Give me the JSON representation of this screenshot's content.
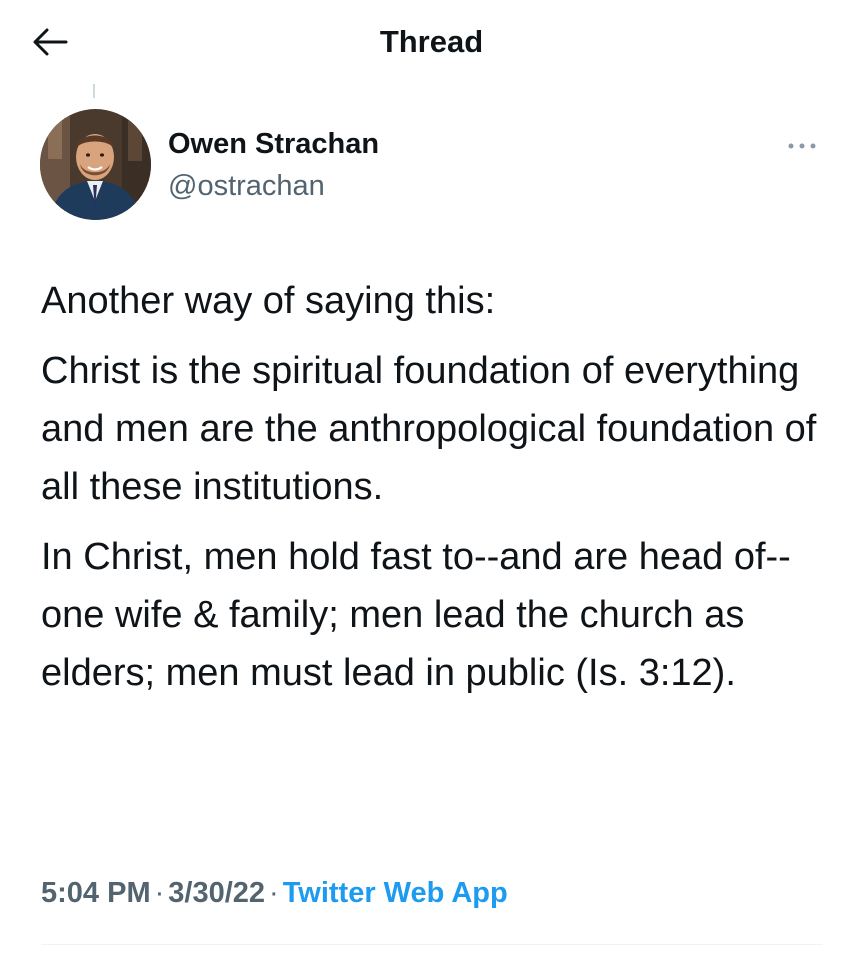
{
  "header": {
    "title": "Thread",
    "back_icon": "arrow-left-icon"
  },
  "tweet": {
    "author": {
      "name": "Owen Strachan",
      "handle": "@ostrachan",
      "avatar": "profile-photo"
    },
    "more_icon": "more-horizontal-icon",
    "paragraphs": [
      "Another way of saying this:",
      "Christ is the spiritual foundation of everything and men are the anthropological foundation of all these institutions.",
      "In Christ, men hold fast to--and are head of--one wife & family; men lead the church as elders; men must lead in public (Is. 3:12)."
    ],
    "time": "5:04 PM",
    "date": "3/30/22",
    "separator": "·",
    "source": "Twitter Web App"
  },
  "colors": {
    "text_primary": "#0f1419",
    "text_secondary": "#536471",
    "accent": "#1d9bf0"
  }
}
